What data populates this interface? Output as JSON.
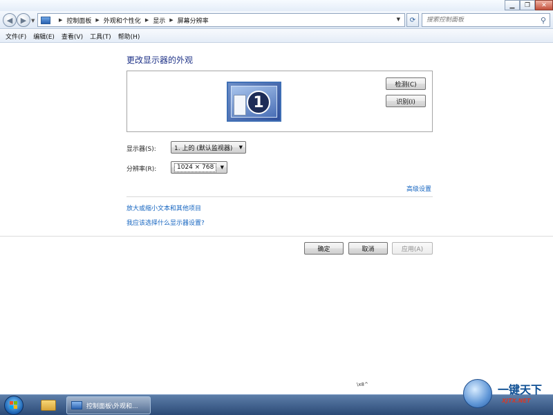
{
  "window": {
    "caption_buttons": [
      "minimize-icon",
      "restore-icon",
      "close-icon"
    ]
  },
  "address_bar": {
    "breadcrumbs": [
      "控制面板",
      "外观和个性化",
      "显示",
      "屏幕分辨率"
    ],
    "search_placeholder": "搜索控制面板"
  },
  "menu": {
    "items": [
      "文件(F)",
      "编辑(E)",
      "查看(V)",
      "工具(T)",
      "帮助(H)"
    ]
  },
  "content": {
    "title": "更改显示器的外观",
    "monitor_number": "1",
    "detect_label": "检测(C)",
    "identify_label": "识别(I)",
    "display_label": "显示器(S):",
    "display_value": "1. 上的 (默认监视器)",
    "resolution_label": "分辨率(R):",
    "resolution_value": "1024 × 768",
    "advanced_link": "高级设置",
    "link_enlarge": "放大或缩小文本和其他项目",
    "link_choose": "我应该选择什么显示器设置?"
  },
  "footer_buttons": {
    "ok": "确定",
    "cancel": "取消",
    "apply": "应用(A)"
  },
  "stray_text": "\\x8^",
  "taskbar": {
    "task_label": "控制面板\\外观和..."
  },
  "watermark": {
    "title": "一键天下",
    "url": "XJTX.NET"
  },
  "colors": {
    "title": "#1e3287",
    "link": "#1565c0",
    "taskbar": "#2b4a76"
  }
}
